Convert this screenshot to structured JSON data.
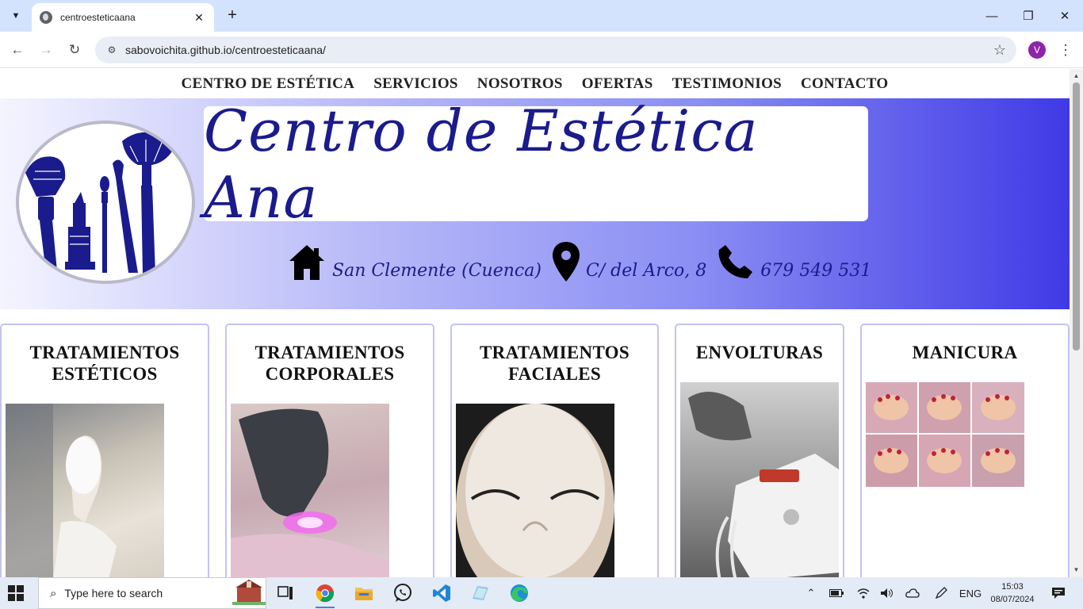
{
  "browser": {
    "tab_title": "centroesteticaana",
    "url": "sabovoichita.github.io/centroesteticaana/",
    "profile_initial": "V"
  },
  "site": {
    "nav": [
      "CENTRO DE ESTÉTICA",
      "SERVICIOS",
      "NOSOTROS",
      "OFERTAS",
      "TESTIMONIOS",
      "CONTACTO"
    ],
    "title": "Centro de Estética Ana",
    "location": "San Clemente (Cuenca)",
    "address": "C/ del Arco, 8",
    "phone": "679 549 531",
    "cards": [
      {
        "title_line1": "TRATAMIENTOS",
        "title_line2": "ESTÉTICOS"
      },
      {
        "title_line1": "TRATAMIENTOS",
        "title_line2": "CORPORALES"
      },
      {
        "title_line1": "TRATAMIENTOS",
        "title_line2": "FACIALES"
      },
      {
        "title_line1": "ENVOLTURAS",
        "title_line2": ""
      },
      {
        "title_line1": "MANICURA",
        "title_line2": ""
      }
    ]
  },
  "taskbar": {
    "search_placeholder": "Type here to search",
    "language": "ENG",
    "time": "15:03",
    "date": "08/07/2024"
  },
  "colors": {
    "brand_navy": "#1a1b8c",
    "hero_gradient_end": "#3f3ae6",
    "card_border": "#c3c3f0"
  }
}
